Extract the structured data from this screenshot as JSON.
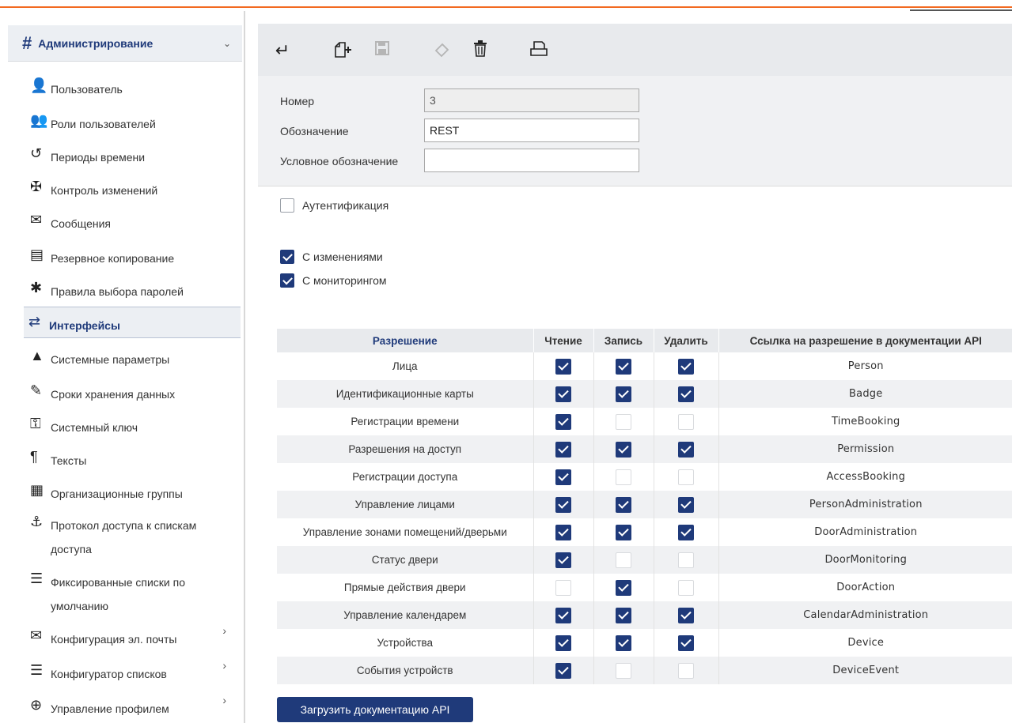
{
  "colors": {
    "accent": "#f26a21",
    "primary": "#1f3a7a"
  },
  "sidebar": {
    "header": {
      "icon": "hash-icon",
      "title": "Администрирование"
    },
    "items": [
      {
        "icon": "user-icon",
        "label": "Пользователь"
      },
      {
        "icon": "users-icon",
        "label": "Роли пользователей"
      },
      {
        "icon": "history-icon",
        "label": "Периоды времени"
      },
      {
        "icon": "signpost-icon",
        "label": "Контроль изменений"
      },
      {
        "icon": "envelope-icon",
        "label": "Сообщения"
      },
      {
        "icon": "archive-icon",
        "label": "Резервное копирование"
      },
      {
        "icon": "asterisk-icon",
        "label": "Правила выбора паролей"
      },
      {
        "icon": "exchange-icon",
        "label": "Интерфейсы",
        "active": true
      },
      {
        "icon": "flask-icon",
        "label": "Системные параметры"
      },
      {
        "icon": "brush-icon",
        "label": "Сроки хранения данных"
      },
      {
        "icon": "key-icon",
        "label": "Системный ключ"
      },
      {
        "icon": "paragraph-icon",
        "label": "Тексты"
      },
      {
        "icon": "building-icon",
        "label": "Организационные группы"
      },
      {
        "icon": "access-person-icon",
        "label": "Протокол доступа к спискам доступа"
      },
      {
        "icon": "list-icon",
        "label": "Фиксированные списки по умолчанию"
      },
      {
        "icon": "envelope-outline-icon",
        "label": "Конфигурация эл. почты",
        "submenu": true
      },
      {
        "icon": "list-icon",
        "label": "Конфигуратор списков",
        "submenu": true
      },
      {
        "icon": "zoom-in-icon",
        "label": "Управление профилем",
        "submenu": true
      }
    ]
  },
  "toolbar": {
    "buttons": [
      {
        "name": "back-button",
        "icon": "return-arrow-icon",
        "enabled": true
      },
      {
        "name": "new-button",
        "icon": "new-document-icon",
        "enabled": true
      },
      {
        "name": "save-button",
        "icon": "floppy-disk-icon",
        "enabled": false
      },
      {
        "name": "erase-button",
        "icon": "eraser-icon",
        "enabled": false
      },
      {
        "name": "delete-button",
        "icon": "trash-icon",
        "enabled": true
      },
      {
        "name": "print-button",
        "icon": "printer-icon",
        "enabled": true
      }
    ]
  },
  "form": {
    "number": {
      "label": "Номер",
      "value": "3"
    },
    "designation": {
      "label": "Обозначение",
      "value": "REST"
    },
    "short_designation": {
      "label": "Условное обозначение",
      "value": ""
    }
  },
  "options": {
    "authentication": {
      "label": "Аутентификация",
      "checked": false
    },
    "with_changes": {
      "label": "С изменениями",
      "checked": true
    },
    "with_monitoring": {
      "label": "С мониторингом",
      "checked": true
    }
  },
  "table": {
    "headers": {
      "permission": "Разрешение",
      "read": "Чтение",
      "write": "Запись",
      "delete": "Удалить",
      "api_link": "Ссылка на разрешение в документации API"
    },
    "rows": [
      {
        "permission": "Лица",
        "read": true,
        "write": true,
        "delete": true,
        "api": "Person"
      },
      {
        "permission": "Идентификационные карты",
        "read": true,
        "write": true,
        "delete": true,
        "api": "Badge"
      },
      {
        "permission": "Регистрации времени",
        "read": true,
        "write": false,
        "delete": false,
        "api": "TimeBooking"
      },
      {
        "permission": "Разрешения на доступ",
        "read": true,
        "write": true,
        "delete": true,
        "api": "Permission"
      },
      {
        "permission": "Регистрации доступа",
        "read": true,
        "write": false,
        "delete": false,
        "api": "AccessBooking"
      },
      {
        "permission": "Управление лицами",
        "read": true,
        "write": true,
        "delete": true,
        "api": "PersonAdministration"
      },
      {
        "permission": "Управление зонами помещений/дверьми",
        "read": true,
        "write": true,
        "delete": true,
        "api": "DoorAdministration"
      },
      {
        "permission": "Статус двери",
        "read": true,
        "write": false,
        "delete": false,
        "api": "DoorMonitoring"
      },
      {
        "permission": "Прямые действия двери",
        "read": false,
        "write": true,
        "delete": false,
        "api": "DoorAction"
      },
      {
        "permission": "Управление календарем",
        "read": true,
        "write": true,
        "delete": true,
        "api": "CalendarAdministration"
      },
      {
        "permission": "Устройства",
        "read": true,
        "write": true,
        "delete": true,
        "api": "Device"
      },
      {
        "permission": "События устройств",
        "read": true,
        "write": false,
        "delete": false,
        "api": "DeviceEvent"
      }
    ]
  },
  "api_button": {
    "label": "Загрузить документацию API"
  }
}
